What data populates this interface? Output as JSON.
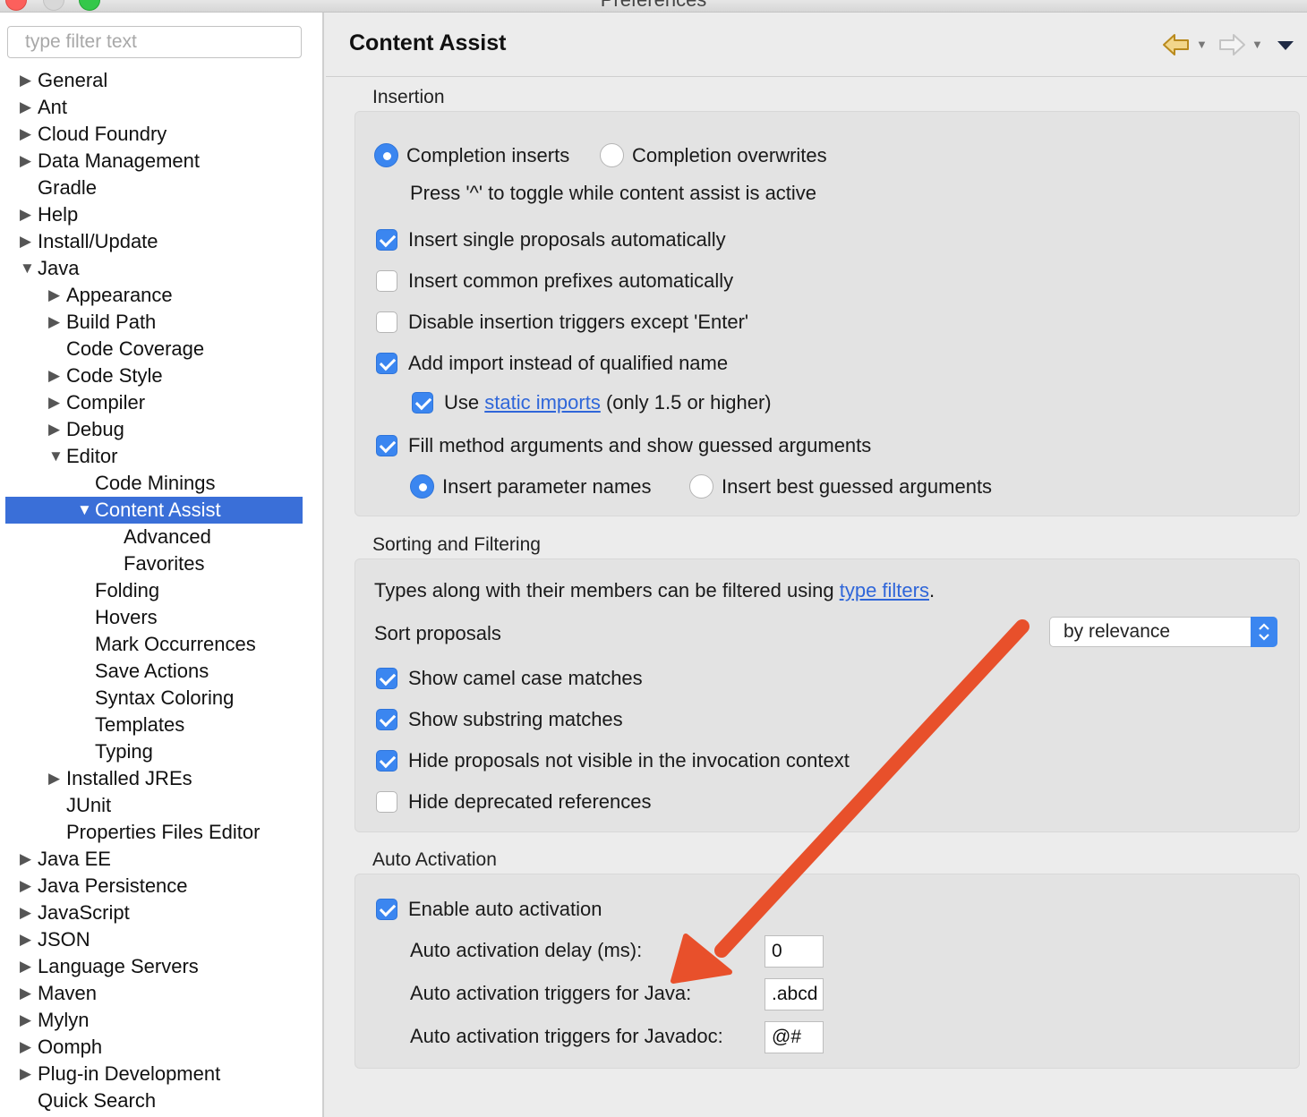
{
  "window": {
    "title": "Preferences"
  },
  "sidebar": {
    "filter_placeholder": "type filter text",
    "tree": [
      {
        "label": "General",
        "level": 0,
        "twisty": "collapsed"
      },
      {
        "label": "Ant",
        "level": 0,
        "twisty": "collapsed"
      },
      {
        "label": "Cloud Foundry",
        "level": 0,
        "twisty": "collapsed"
      },
      {
        "label": "Data Management",
        "level": 0,
        "twisty": "collapsed"
      },
      {
        "label": "Gradle",
        "level": 0,
        "twisty": "none"
      },
      {
        "label": "Help",
        "level": 0,
        "twisty": "collapsed"
      },
      {
        "label": "Install/Update",
        "level": 0,
        "twisty": "collapsed"
      },
      {
        "label": "Java",
        "level": 0,
        "twisty": "expanded"
      },
      {
        "label": "Appearance",
        "level": 1,
        "twisty": "collapsed"
      },
      {
        "label": "Build Path",
        "level": 1,
        "twisty": "collapsed"
      },
      {
        "label": "Code Coverage",
        "level": 1,
        "twisty": "none"
      },
      {
        "label": "Code Style",
        "level": 1,
        "twisty": "collapsed"
      },
      {
        "label": "Compiler",
        "level": 1,
        "twisty": "collapsed"
      },
      {
        "label": "Debug",
        "level": 1,
        "twisty": "collapsed"
      },
      {
        "label": "Editor",
        "level": 1,
        "twisty": "expanded"
      },
      {
        "label": "Code Minings",
        "level": 2,
        "twisty": "none"
      },
      {
        "label": "Content Assist",
        "level": 2,
        "twisty": "expanded",
        "selected": true
      },
      {
        "label": "Advanced",
        "level": 3,
        "twisty": "none"
      },
      {
        "label": "Favorites",
        "level": 3,
        "twisty": "none"
      },
      {
        "label": "Folding",
        "level": 2,
        "twisty": "none"
      },
      {
        "label": "Hovers",
        "level": 2,
        "twisty": "none"
      },
      {
        "label": "Mark Occurrences",
        "level": 2,
        "twisty": "none"
      },
      {
        "label": "Save Actions",
        "level": 2,
        "twisty": "none"
      },
      {
        "label": "Syntax Coloring",
        "level": 2,
        "twisty": "none"
      },
      {
        "label": "Templates",
        "level": 2,
        "twisty": "none"
      },
      {
        "label": "Typing",
        "level": 2,
        "twisty": "none"
      },
      {
        "label": "Installed JREs",
        "level": 1,
        "twisty": "collapsed"
      },
      {
        "label": "JUnit",
        "level": 1,
        "twisty": "none"
      },
      {
        "label": "Properties Files Editor",
        "level": 1,
        "twisty": "none"
      },
      {
        "label": "Java EE",
        "level": 0,
        "twisty": "collapsed"
      },
      {
        "label": "Java Persistence",
        "level": 0,
        "twisty": "collapsed"
      },
      {
        "label": "JavaScript",
        "level": 0,
        "twisty": "collapsed"
      },
      {
        "label": "JSON",
        "level": 0,
        "twisty": "collapsed"
      },
      {
        "label": "Language Servers",
        "level": 0,
        "twisty": "collapsed"
      },
      {
        "label": "Maven",
        "level": 0,
        "twisty": "collapsed"
      },
      {
        "label": "Mylyn",
        "level": 0,
        "twisty": "collapsed"
      },
      {
        "label": "Oomph",
        "level": 0,
        "twisty": "collapsed"
      },
      {
        "label": "Plug-in Development",
        "level": 0,
        "twisty": "collapsed"
      },
      {
        "label": "Quick Search",
        "level": 0,
        "twisty": "none"
      }
    ]
  },
  "page": {
    "title": "Content Assist",
    "icons": [
      "back-arrow-icon",
      "forward-arrow-icon",
      "view-menu-icon"
    ]
  },
  "insertion": {
    "title": "Insertion",
    "completion_inserts": {
      "label": "Completion inserts",
      "selected": true
    },
    "completion_overwrites": {
      "label": "Completion overwrites",
      "selected": false
    },
    "toggle_hint": "Press '^' to toggle while content assist is active",
    "insert_single": {
      "label": "Insert single proposals automatically",
      "checked": true
    },
    "insert_prefixes": {
      "label": "Insert common prefixes automatically",
      "checked": false
    },
    "disable_triggers": {
      "label": "Disable insertion triggers except 'Enter'",
      "checked": false
    },
    "add_import": {
      "label": "Add import instead of qualified name",
      "checked": true
    },
    "use_static": {
      "prefix": "Use ",
      "link": "static imports",
      "suffix": " (only 1.5 or higher)",
      "checked": true
    },
    "fill_args": {
      "label": "Fill method arguments and show guessed arguments",
      "checked": true
    },
    "param_names": {
      "label": "Insert parameter names",
      "selected": true
    },
    "best_guessed": {
      "label": "Insert best guessed arguments",
      "selected": false
    }
  },
  "sorting": {
    "title": "Sorting and Filtering",
    "filter_text": {
      "prefix": "Types along with their members can be filtered using ",
      "link": "type filters",
      "suffix": "."
    },
    "sort_label": "Sort proposals",
    "sort_value": "by relevance",
    "camel_case": {
      "label": "Show camel case matches",
      "checked": true
    },
    "substring": {
      "label": "Show substring matches",
      "checked": true
    },
    "hide_invisible": {
      "label": "Hide proposals not visible in the invocation context",
      "checked": true
    },
    "hide_deprecated": {
      "label": "Hide deprecated references",
      "checked": false
    }
  },
  "auto_activation": {
    "title": "Auto Activation",
    "enable": {
      "label": "Enable auto activation",
      "checked": true
    },
    "delay_label": "Auto activation delay (ms):",
    "delay_value": "0",
    "java_triggers_label": "Auto activation triggers for Java:",
    "java_triggers_value": ".abcd",
    "javadoc_triggers_label": "Auto activation triggers for Javadoc:",
    "javadoc_triggers_value": "@#"
  },
  "colors": {
    "accent": "#3b86f0",
    "selection": "#3a6fd8",
    "link": "#2f66d9",
    "annotation_arrow": "#e8502b"
  }
}
